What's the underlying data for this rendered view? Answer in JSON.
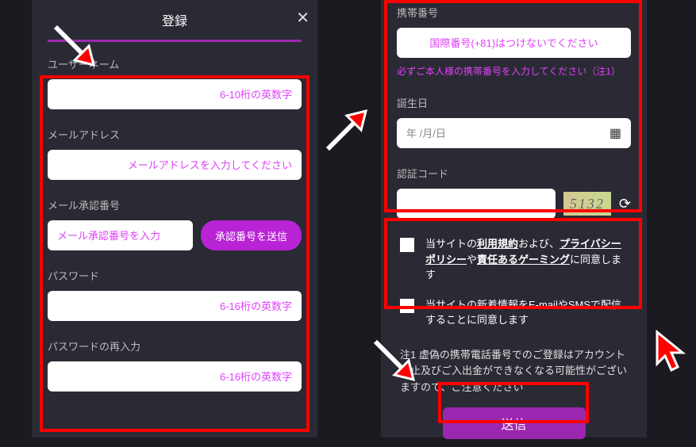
{
  "modal": {
    "title": "登録"
  },
  "left": {
    "username": {
      "label": "ユーザーネーム",
      "placeholder": "6-10桁の英数字"
    },
    "email": {
      "label": "メールアドレス",
      "placeholder": "メールアドレスを入力してください"
    },
    "emailVerify": {
      "label": "メール承認番号",
      "placeholder": "メール承認番号を入力",
      "buttonLabel": "承認番号を送信"
    },
    "password": {
      "label": "パスワード",
      "placeholder": "6-16桁の英数字"
    },
    "passwordConfirm": {
      "label": "パスワードの再入力",
      "placeholder": "6-16桁の英数字"
    }
  },
  "right": {
    "phone": {
      "label": "携帯番号",
      "placeholder": "国際番号(+81)はつけないでください",
      "help": "必ずご本人様の携帯番号を入力してください（注1）"
    },
    "birthday": {
      "label": "誕生日",
      "placeholder": "年 /月/日"
    },
    "captcha": {
      "label": "認証コード",
      "imageText": "5132"
    },
    "consent": {
      "termsPrefix": "当サイトの",
      "termsLink1": "利用規約",
      "termsMid1": "および、",
      "termsLink2": "プライバシーポリシー",
      "termsMid2": "や",
      "termsLink3": "責任あるゲーミング",
      "termsSuffix": "に同意します",
      "marketing": "当サイトの新着情報をE-mailやSMSで配信することに同意します"
    },
    "note": "注1 虚偽の携帯電話番号でのご登録はアカウント停止及びご入出金ができなくなる可能性がございますので、ご注意ください",
    "submitLabel": "送信"
  }
}
